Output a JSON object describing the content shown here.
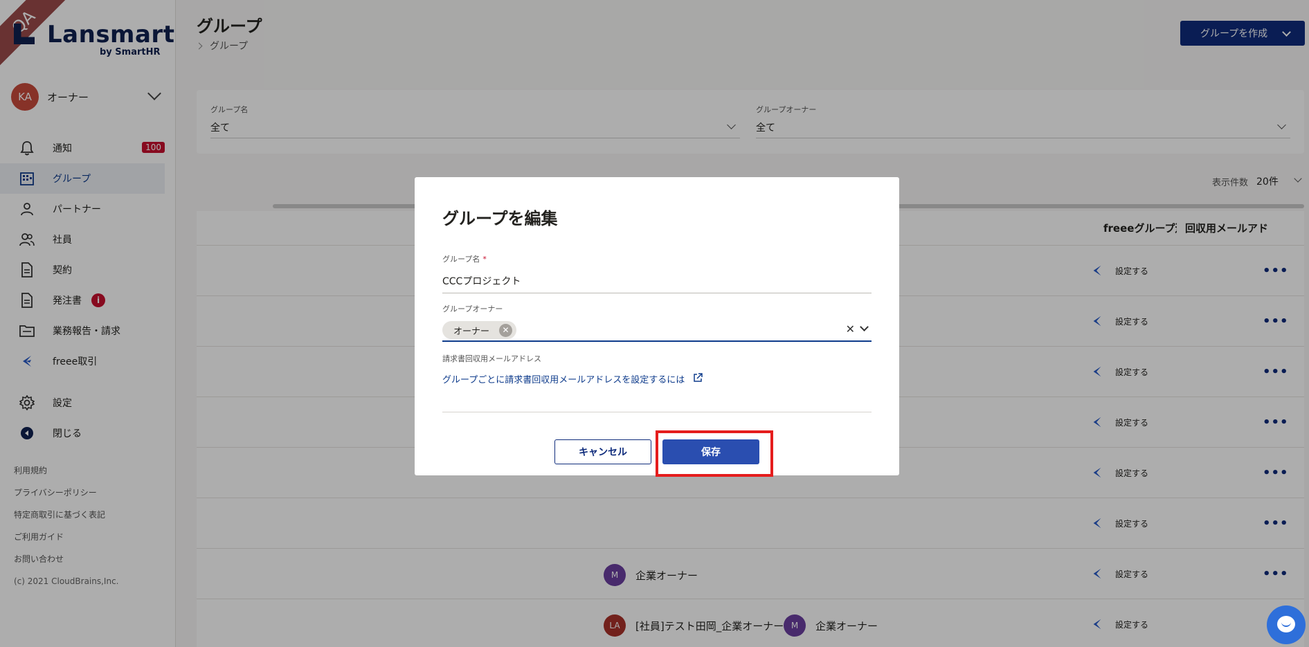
{
  "brand": {
    "name": "Lansmart",
    "by": "by SmartHR",
    "ribbon": "QA"
  },
  "account": {
    "initials": "KA",
    "name": "オーナー"
  },
  "nav": {
    "items": [
      {
        "label": "通知",
        "badge": "100"
      },
      {
        "label": "グループ"
      },
      {
        "label": "パートナー"
      },
      {
        "label": "社員"
      },
      {
        "label": "契約"
      },
      {
        "label": "発注書",
        "alert": "i"
      },
      {
        "label": "業務報告・請求"
      },
      {
        "label": "freee取引"
      },
      {
        "label": "設定"
      },
      {
        "label": "閉じる"
      }
    ]
  },
  "footer": {
    "links": [
      "利用規約",
      "プライバシーポリシー",
      "特定商取引に基づく表記",
      "ご利用ガイド",
      "お問い合わせ"
    ],
    "copyright": "(c) 2021 CloudBrains,Inc."
  },
  "header": {
    "title": "グループ",
    "breadcrumb": "グループ",
    "create_button": "グループを作成"
  },
  "filters": {
    "group_name": {
      "label": "グループ名",
      "value": "全て"
    },
    "group_owner": {
      "label": "グループオーナー",
      "value": "全て"
    }
  },
  "perpage": {
    "label": "表示件数",
    "value": "20件"
  },
  "table": {
    "headers": {
      "freee": "freeeグループ連",
      "mail": "回収用メールアドレ"
    },
    "set_label": "設定する",
    "more": "•••",
    "owner_row7": {
      "initials": "M",
      "name": "企業オーナー"
    },
    "owner_row8a": {
      "initials": "LA",
      "name": "[社員]テスト田岡_企業オーナー"
    },
    "owner_row8b": {
      "initials": "M",
      "name": "企業オーナー"
    }
  },
  "modal": {
    "title": "グループを編集",
    "name_label": "グループ名",
    "required_mark": "*",
    "name_value": "CCCプロジェクト",
    "owner_label": "グループオーナー",
    "owner_chip": "オーナー",
    "mail_label": "請求書回収用メールアドレス",
    "mail_link": "グループごとに請求書回収用メールアドレスを設定するには",
    "cancel": "キャンセル",
    "save": "保存"
  },
  "colors": {
    "primary": "#0f2c7c",
    "save": "#2a4eb0",
    "danger": "#c8102e",
    "highlight": "#e51d1d"
  }
}
